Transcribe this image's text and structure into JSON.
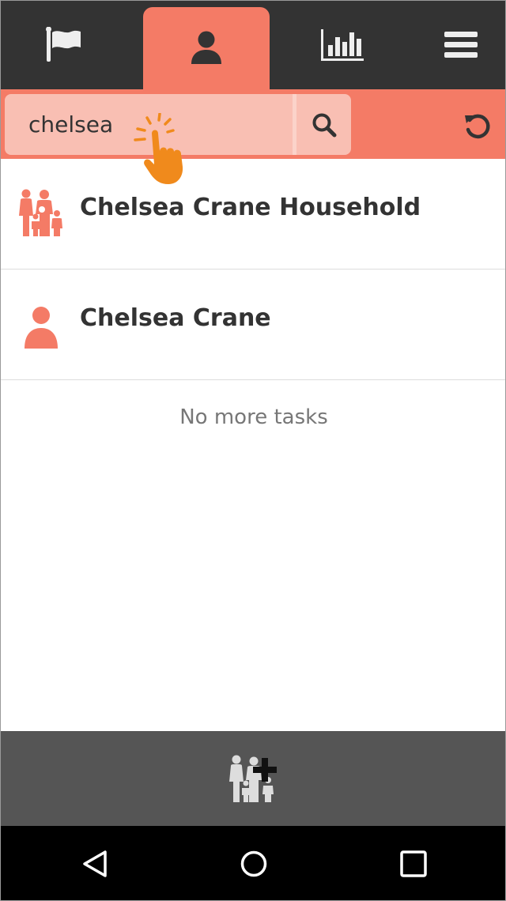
{
  "nav": {
    "tabs": [
      {
        "icon": "flag-icon"
      },
      {
        "icon": "person-icon",
        "active": true
      },
      {
        "icon": "bar-chart-icon"
      },
      {
        "icon": "menu-icon"
      }
    ]
  },
  "search": {
    "value": "chelsea",
    "placeholder": ""
  },
  "results": [
    {
      "label": "Chelsea Crane Household",
      "icon": "family-icon"
    },
    {
      "label": "Chelsea Crane",
      "icon": "person-icon"
    }
  ],
  "empty_message": "No more tasks",
  "colors": {
    "accent": "#f47b66",
    "nav_bg": "#333333",
    "search_field": "#f9bfb3",
    "bottom_bar": "#555555",
    "hand": "#f08a1c"
  }
}
